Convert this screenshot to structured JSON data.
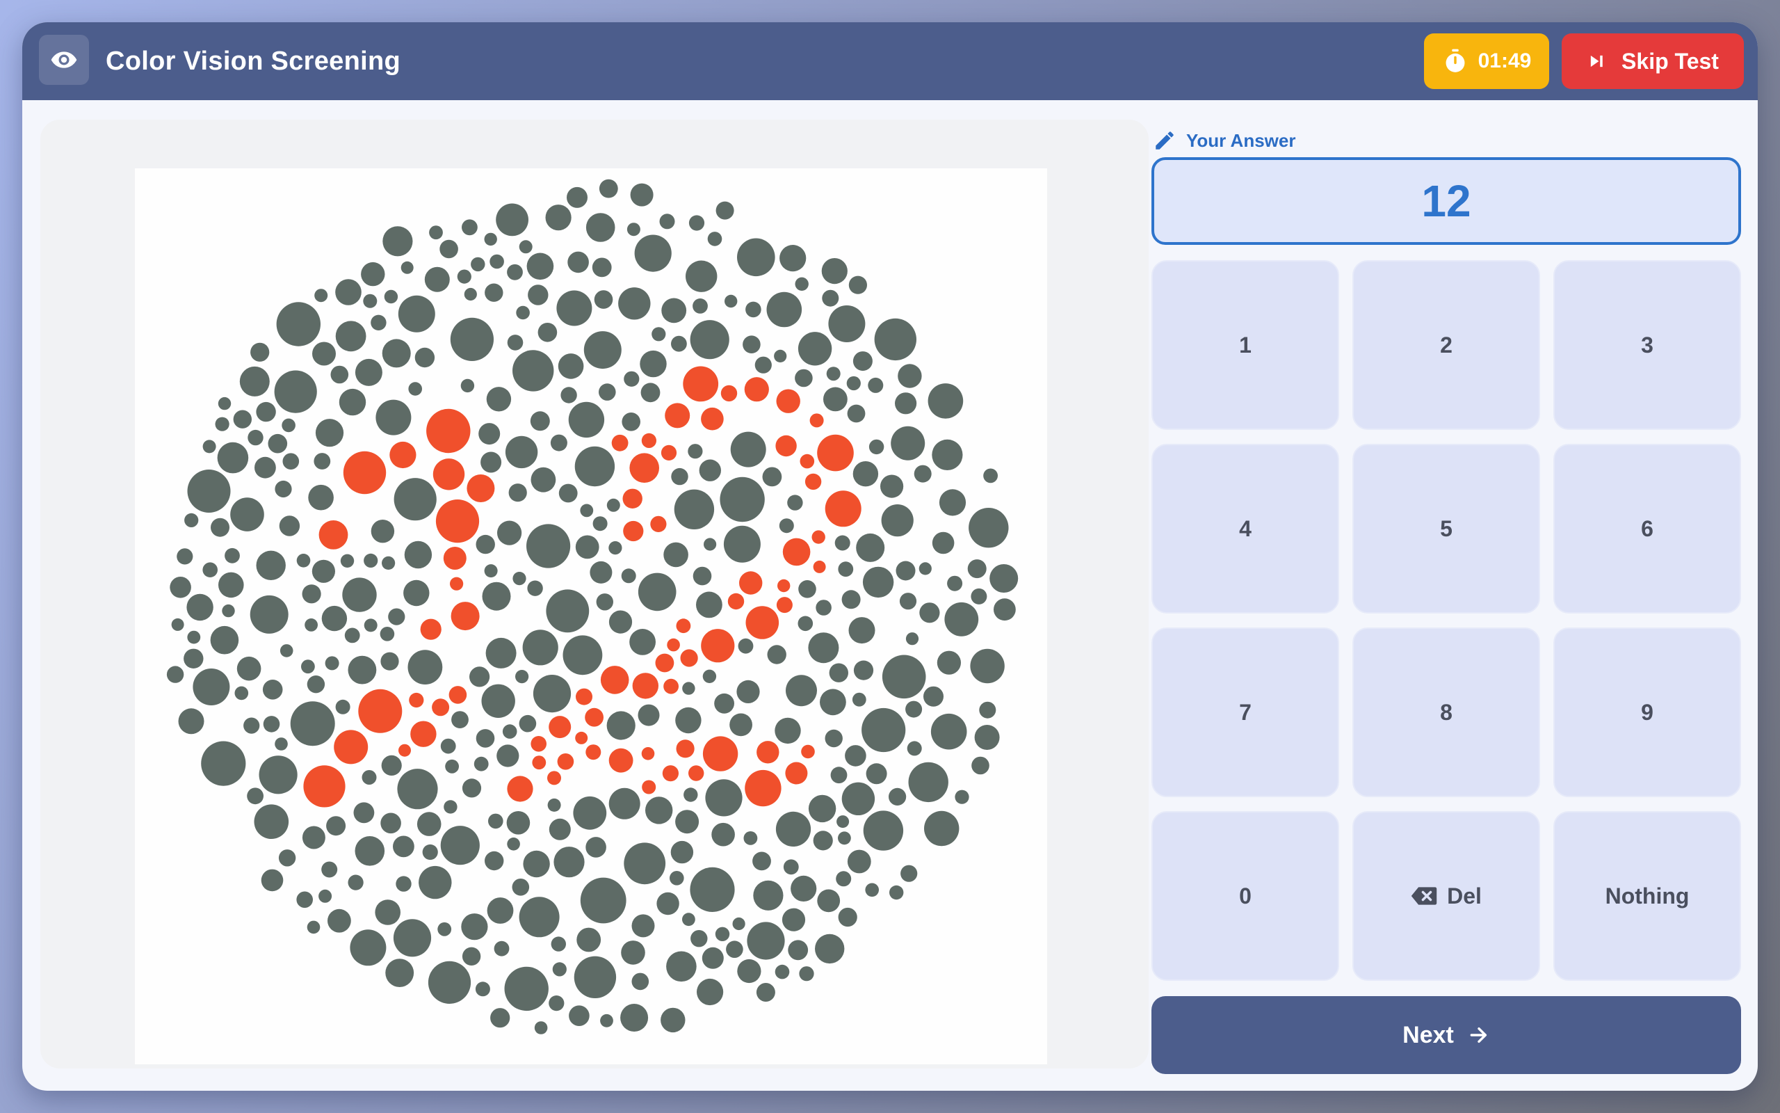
{
  "app": {
    "title": "Color Vision Screening",
    "logo_icon": "eye-icon"
  },
  "header": {
    "timer": "01:49",
    "timer_icon": "stopwatch-icon",
    "skip_label": "Skip Test",
    "skip_icon": "skip-next-icon"
  },
  "plate": {
    "description_icon": "ishihara-plate",
    "digits_shown": "12"
  },
  "answer": {
    "label": "Your Answer",
    "label_icon": "pencil-icon",
    "value": "12"
  },
  "keypad": {
    "keys": [
      "1",
      "2",
      "3",
      "4",
      "5",
      "6",
      "7",
      "8",
      "9",
      "0"
    ],
    "delete_label": "Del",
    "delete_icon": "backspace-icon",
    "nothing_label": "Nothing"
  },
  "footer": {
    "next_label": "Next",
    "next_icon": "arrow-right-icon"
  },
  "colors": {
    "header": "#4c5d8c",
    "timer": "#f8b50d",
    "skip": "#e53a3a",
    "accent": "#2e74cc",
    "key": "#dde2f7",
    "dot_gray": "#5e6b66",
    "dot_red": "#f0502c"
  }
}
